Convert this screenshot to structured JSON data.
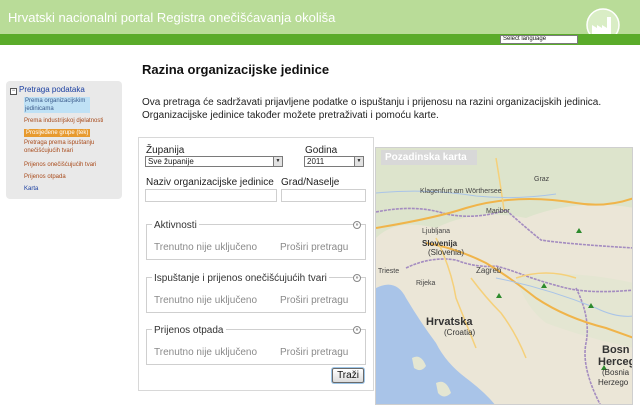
{
  "header": {
    "title": "Hrvatski nacionalni portal Registra onečišćavanja okoliša",
    "language_select": "Select language"
  },
  "sidebar": {
    "heading": "Pretraga podataka",
    "items": [
      {
        "label": "Prema organizacijskim jedinicama"
      },
      {
        "label": "Prema industrijskoj djelatnosti"
      },
      {
        "label": "Prosljeđene grupe (tek)"
      },
      {
        "label": "Pretraga prema ispuštanju onečišćujućih tvari"
      },
      {
        "label": "Prijenos onečišćujućih tvari"
      },
      {
        "label": "Prijenos otpada"
      },
      {
        "label": "Karta"
      }
    ]
  },
  "main": {
    "title": "Razina organizacijske jedinice",
    "intro_line1": "Ova pretraga će sadržavati prijavljene podatke o ispuštanju i prijenosu na razini organizacijskih jedinica.",
    "intro_line2": "Organizacijske jedinice također možete pretraživati i pomoću karte."
  },
  "form": {
    "county_label": "Županija",
    "county_value": "Sve županije",
    "year_label": "Godina",
    "year_value": "2011",
    "org_name_label": "Naziv organizacijske jedinice",
    "city_label": "Grad/Naselje",
    "sections": [
      {
        "title": "Aktivnosti",
        "note": "Trenutno nije uključeno",
        "link": "Proširi pretragu"
      },
      {
        "title": "Ispuštanje i prijenos onečišćujućih tvari",
        "note": "Trenutno nije uključeno",
        "link": "Proširi pretragu"
      },
      {
        "title": "Prijenos otpada",
        "note": "Trenutno nije uključeno",
        "link": "Proširi pretragu"
      }
    ],
    "search_button": "Traži"
  },
  "map": {
    "label": "Pozadinska karta",
    "places": {
      "klagenfurt": "Klagenfurt am Wörthersee",
      "graz": "Graz",
      "slovenija": "Slovenija",
      "slovenija_sub": "(Slovenia)",
      "ljubljana": "Ljubljana",
      "maribor": "Maribor",
      "zagreb": "Zagreb",
      "trieste": "Trieste",
      "rijeka": "Rijeka",
      "hrvatska": "Hrvatska",
      "hrvatska_sub": "(Croatia)",
      "bosn": "Bosn",
      "herceg": "Herceg",
      "bosnia_sub": "(Bosnia",
      "herzego": "Herzego"
    }
  },
  "colors": {
    "header_light": "#b9dc98",
    "header_dark": "#5aab2a",
    "sidebar_bg": "#e9e9e9",
    "link_blue": "#1a3ea0",
    "accent_orange": "#e79a2f"
  }
}
